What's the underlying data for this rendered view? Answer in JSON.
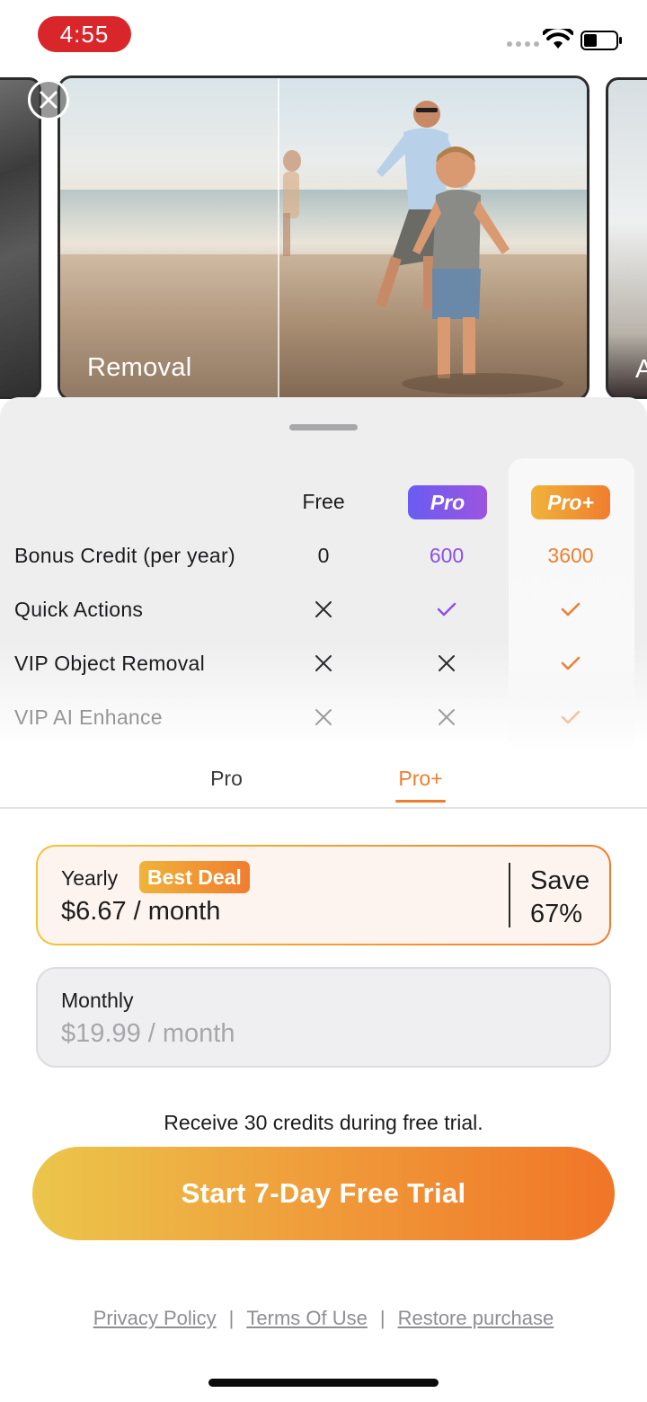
{
  "status_bar": {
    "time": "4:55"
  },
  "carousel": {
    "main_caption": "Removal",
    "next_caption": "A"
  },
  "comparison": {
    "columns": {
      "free": "Free",
      "pro": "Pro",
      "pro_plus": "Pro+"
    },
    "rows": [
      {
        "label": "Bonus Credit (per year)",
        "free": "0",
        "pro": "600",
        "pro_plus": "3600"
      },
      {
        "label": "Quick Actions",
        "free": "cross",
        "pro": "check",
        "pro_plus": "check"
      },
      {
        "label": "VIP Object Removal",
        "free": "cross",
        "pro": "cross",
        "pro_plus": "check"
      },
      {
        "label": "VIP AI Enhance",
        "free": "cross",
        "pro": "cross",
        "pro_plus": "check"
      }
    ]
  },
  "tabs": {
    "pro": "Pro",
    "pro_plus": "Pro+",
    "active": "pro_plus"
  },
  "plans": {
    "yearly": {
      "name": "Yearly",
      "badge": "Best Deal",
      "price": "$6.67 / month",
      "save_line1": "Save",
      "save_line2": "67%"
    },
    "monthly": {
      "name": "Monthly",
      "price": "$19.99 / month"
    }
  },
  "trial_note": "Receive 30 credits during free trial.",
  "cta_label": "Start 7-Day Free Trial",
  "footer": {
    "privacy": "Privacy Policy",
    "separator": "|",
    "terms": "Terms Of Use",
    "restore": "Restore purchase"
  },
  "colors": {
    "pro_accent": "#8a52e3",
    "pro_plus_accent": "#f07d2e",
    "time_pill": "#d9262b"
  }
}
